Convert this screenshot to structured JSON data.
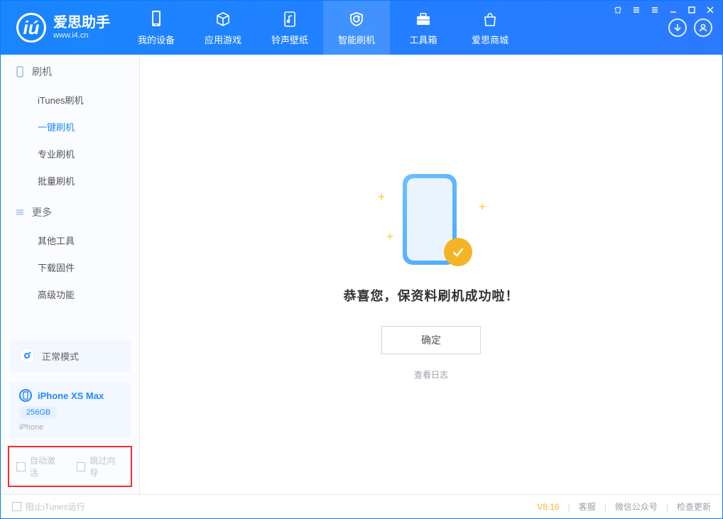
{
  "app": {
    "name_cn": "爱思助手",
    "name_en": "www.i4.cn"
  },
  "topTabs": [
    {
      "label": "我的设备"
    },
    {
      "label": "应用游戏"
    },
    {
      "label": "铃声壁纸"
    },
    {
      "label": "智能刷机"
    },
    {
      "label": "工具箱"
    },
    {
      "label": "爱思商城"
    }
  ],
  "sidebar": {
    "section1_title": "刷机",
    "items1": [
      {
        "label": "iTunes刷机"
      },
      {
        "label": "一键刷机"
      },
      {
        "label": "专业刷机"
      },
      {
        "label": "批量刷机"
      }
    ],
    "section2_title": "更多",
    "items2": [
      {
        "label": "其他工具"
      },
      {
        "label": "下载固件"
      },
      {
        "label": "高级功能"
      }
    ],
    "mode_label": "正常模式",
    "device": {
      "name": "iPhone XS Max",
      "storage": "256GB",
      "type": "iPhone"
    },
    "opts": {
      "auto_activate": "自动激活",
      "skip_guide": "跳过向导"
    }
  },
  "main": {
    "success_text": "恭喜您，保资料刷机成功啦！",
    "ok_button": "确定",
    "view_log": "查看日志"
  },
  "statusbar": {
    "block_itunes": "阻止iTunes运行",
    "version": "V8.16",
    "kefu": "客服",
    "wechat": "微信公众号",
    "check_update": "检查更新"
  }
}
